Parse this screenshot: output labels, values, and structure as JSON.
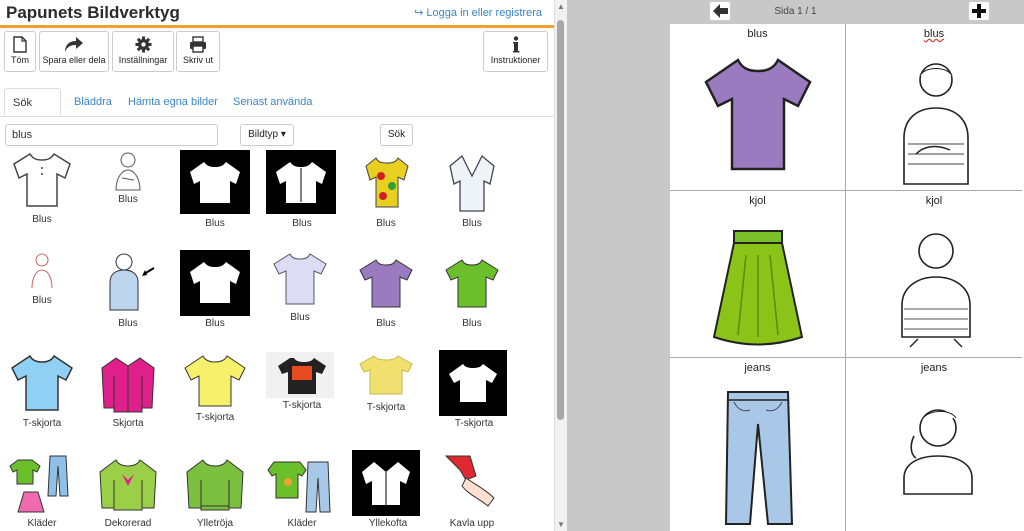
{
  "app": {
    "title": "Papunets Bildverktyg",
    "login": "Logga in eller registrera"
  },
  "toolbar": {
    "new_label": "Töm",
    "share_label": "Spara eller dela",
    "settings_label": "Inställningar",
    "print_label": "Skriv ut",
    "instructions_label": "Instruktioner"
  },
  "tabs": [
    "Sök bild",
    "Bläddra",
    "Hämta egna bilder",
    "Senast använda"
  ],
  "search": {
    "value": "blus",
    "type_label": "Bildtyp",
    "button": "Sök"
  },
  "results": [
    "Blus",
    "Blus",
    "Blus",
    "Blus",
    "Blus",
    "Blus",
    "Blus",
    "Blus",
    "Blus",
    "Blus",
    "Blus",
    "Blus",
    "T-skjorta",
    "Skjorta",
    "T-skjorta",
    "T-skjorta",
    "T-skjorta",
    "T-skjorta",
    "Kläder",
    "Dekorerad",
    "Ylletröja",
    "Kläder",
    "Yllekofta",
    "Kavla upp"
  ],
  "pager": {
    "label": "Sida 1 / 1"
  },
  "board": [
    "blus",
    "blus",
    "kjol",
    "kjol",
    "jeans",
    "jeans"
  ],
  "colors": {
    "accent": "#f0a030",
    "link": "#3a86c8",
    "purple_shirt": "#9b7bc0",
    "green_skirt": "#8cc318",
    "jeans": "#a9c7e6"
  }
}
